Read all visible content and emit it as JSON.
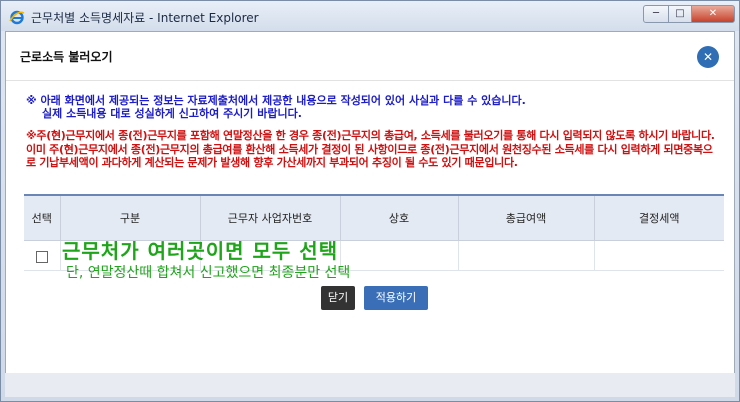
{
  "window": {
    "title": "근무처별 소득명세자료 - Internet Explorer",
    "min_label": "─",
    "max_label": "□",
    "close_label": "✕"
  },
  "modal": {
    "title": "근로소득 불러오기",
    "close_label": "✕"
  },
  "notice": {
    "line1": "※ 아래 화면에서 제공되는 정보는 자료제출처에서 제공한 내용으로 작성되어 있어 사실과 다를 수 있습니다.",
    "line2": "실제 소득내용 대로 성실하게 신고하여 주시기 바랍니다."
  },
  "warning": {
    "text": "※주(현)근무지에서 종(전)근무지를 포함해 연말정산을 한 경우 종(전)근무지의 총급여, 소득세를 불러오기를 통해 다시 입력되지 않도록 하시기 바랍니다.이미 주(현)근무지에서 종(전)근무지의 총급여를 환산해 소득세가 결정이 된 사항이므로 종(전)근무지에서 원천징수된 소득세를 다시 입력하게 되면중복으로 기납부세액이 과다하게 계산되는 문제가 발생해 향후 가산세까지 부과되어 추징이 될 수도 있기 때문입니다."
  },
  "table": {
    "headers": [
      "선택",
      "구분",
      "근무자 사업자번호",
      "상호",
      "총급여액",
      "결정세액"
    ]
  },
  "annotation": {
    "line1": "근무처가 여러곳이면 모두 선택",
    "line2": "단, 연말정산때 합쳐서 신고했으면 최종분만 선택"
  },
  "buttons": {
    "close": "닫기",
    "apply": "적용하기"
  },
  "colors": {
    "notice": "#1c1cc8",
    "warning": "#d01010",
    "annotation": "#1fa51a",
    "accent": "#3a6fb8"
  }
}
